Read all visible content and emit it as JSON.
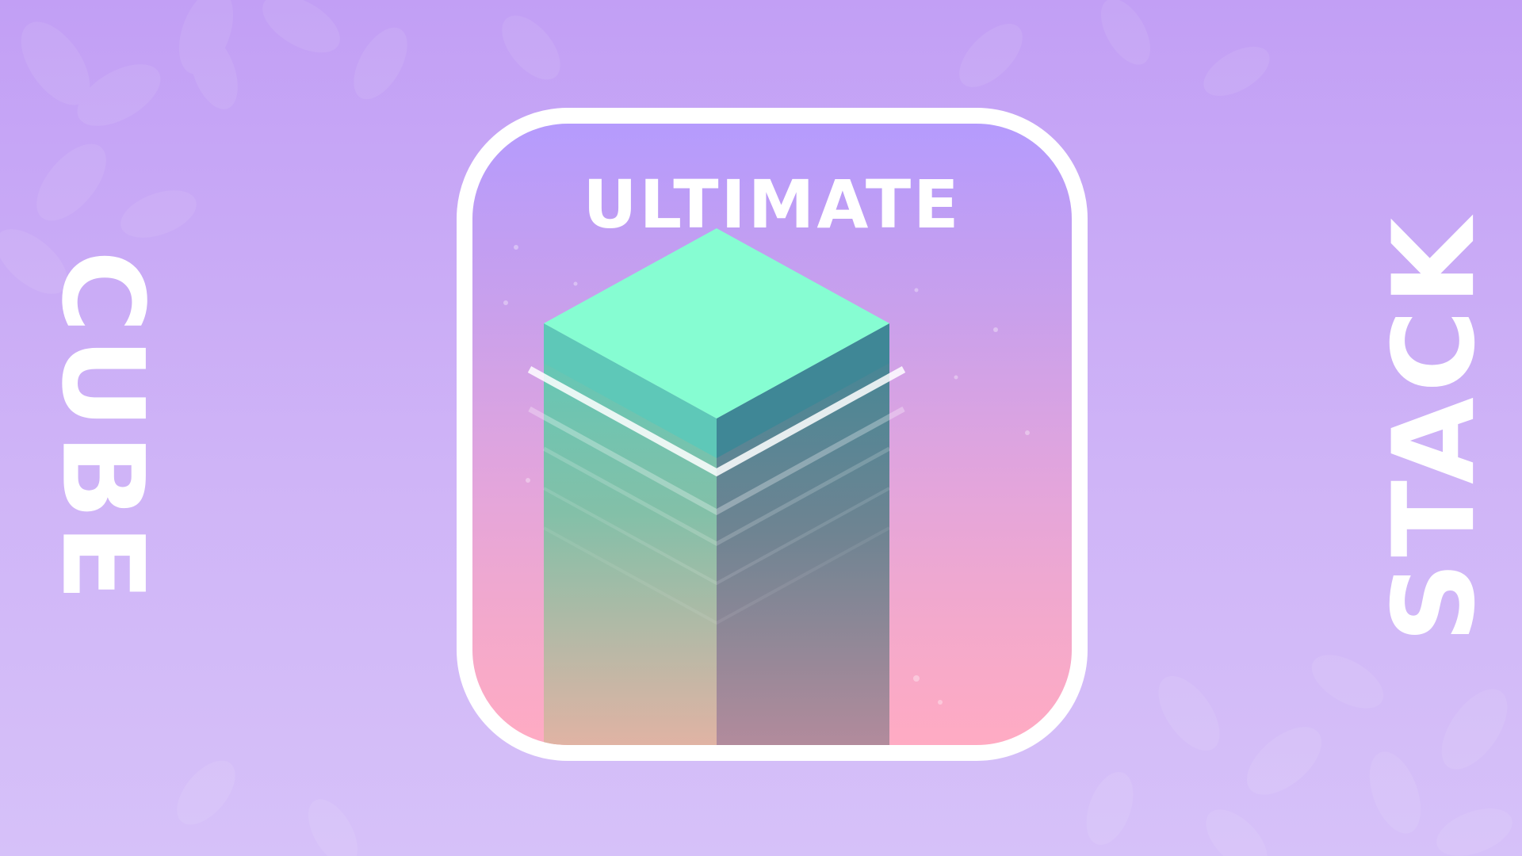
{
  "banner": {
    "left_word": "CUBE",
    "right_word": "STACK"
  },
  "icon": {
    "title": "ULTIMATE",
    "colors": {
      "cube_top": "#86fdd2",
      "cube_left": "#5ec8b8",
      "cube_right": "#3f8796",
      "outline": "#ffffff",
      "gradient_top": "#b59bfd",
      "gradient_bottom": "#ffabc3"
    }
  },
  "background": {
    "colors": {
      "top": "#c29ff5",
      "bottom": "#d6c1f9"
    },
    "pattern": "leaf-pattern"
  }
}
